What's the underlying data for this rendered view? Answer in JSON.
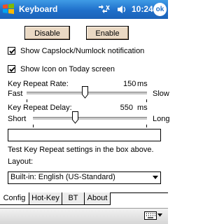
{
  "titlebar": {
    "title": "Keyboard",
    "clock": "10:24",
    "ok_label": "ok",
    "icons": [
      "windows-logo-icon",
      "connectivity-icon",
      "speaker-icon"
    ]
  },
  "buttons": {
    "disable_label": "Disable",
    "enable_label": "Enable"
  },
  "options": {
    "capslock_label": "Show Capslock/Numlock notification",
    "capslock_checked": true,
    "today_label": "Show Icon on Today screen",
    "today_checked": true
  },
  "repeat_rate": {
    "label": "Key Repeat Rate:",
    "value": "150",
    "unit": "ms",
    "min_label": "Fast",
    "max_label": "Slow",
    "level": 0.48
  },
  "repeat_delay": {
    "label": "Key Repeat Delay:",
    "value": "550",
    "unit": "ms",
    "min_label": "Short",
    "max_label": "Long",
    "level": 0.37
  },
  "test": {
    "value": "",
    "hint": "Test Key Repeat settings in the box above."
  },
  "layout": {
    "label": "Layout:",
    "selected": "Built-in: English (US-Standard)"
  },
  "tabs": [
    {
      "label": "Config",
      "active": true
    },
    {
      "label": "Hot-Key",
      "active": false
    },
    {
      "label": "BT",
      "active": false
    },
    {
      "label": "About",
      "active": false
    }
  ],
  "colors": {
    "titlebar": "#1f6fc9",
    "button_face": "#ead9c4"
  }
}
